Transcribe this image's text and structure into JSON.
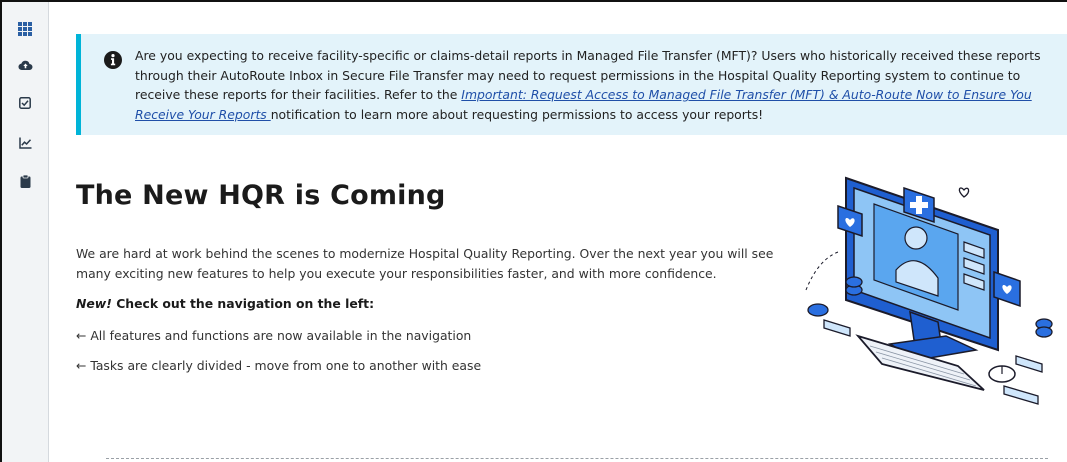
{
  "sidebar": {
    "items": [
      {
        "icon": "grid-icon"
      },
      {
        "icon": "cloud-upload-icon"
      },
      {
        "icon": "checkbox-icon"
      },
      {
        "icon": "chart-line-icon"
      },
      {
        "icon": "clipboard-icon"
      }
    ]
  },
  "banner": {
    "icon": "info-circle-icon",
    "text_before": "Are you expecting to receive facility-specific or claims-detail reports in Managed File Transfer (MFT)? Users who historically received these reports through their AutoRoute Inbox in Secure File Transfer may need to request permissions in the Hospital Quality Reporting system to continue to receive these reports for their facilities. Refer to the ",
    "link_text": "Important: Request Access to Managed File Transfer (MFT) & Auto-Route Now to Ensure You Receive Your Reports ",
    "text_after": "notification to learn more about requesting permissions to access your reports!"
  },
  "main": {
    "title": "The New HQR is Coming",
    "intro": "We are hard at work behind the scenes to modernize Hospital Quality Reporting. Over the next year you will see many exciting new features to help you execute your responsibilities faster, and with more confidence.",
    "callout_new": "New!",
    "callout_text": " Check out the navigation on the left:",
    "bullets": [
      "← All features and functions are now available in the navigation",
      "← Tasks are clearly divided - move from one to another with ease"
    ]
  },
  "colors": {
    "banner_bg": "#e3f3fa",
    "banner_accent": "#00b4d8",
    "link": "#1f4fa8",
    "nav_icon": "#2b3a4a"
  }
}
